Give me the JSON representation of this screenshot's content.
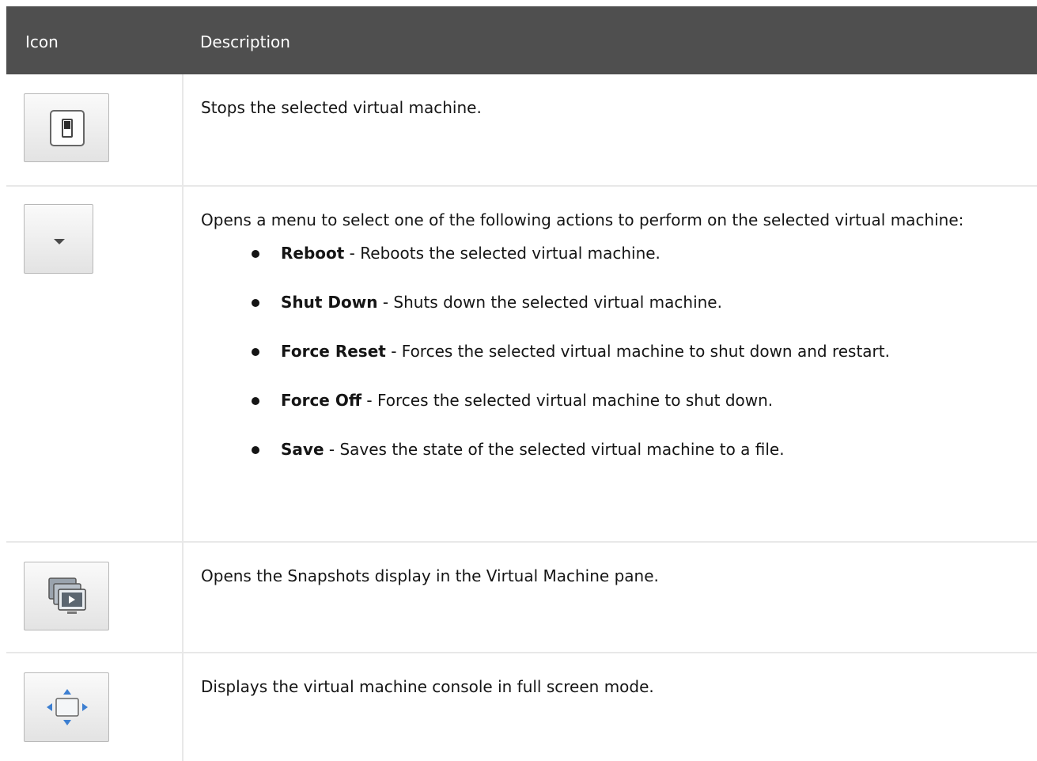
{
  "table": {
    "headers": {
      "icon": "Icon",
      "description": "Description"
    },
    "rows": [
      {
        "icon": "stop-switch-icon",
        "description": "Stops the selected virtual machine."
      },
      {
        "icon": "dropdown-arrow-icon",
        "description": "Opens a menu to select one of the following actions to perform on the selected virtual machine:",
        "actions": [
          {
            "term": "Reboot",
            "text": " - Reboots the selected virtual machine."
          },
          {
            "term": "Shut Down",
            "text": " - Shuts down the selected virtual machine."
          },
          {
            "term": "Force Reset",
            "text": " - Forces the selected virtual machine to shut down and restart."
          },
          {
            "term": "Force Off",
            "text": " - Forces the selected virtual machine to shut down."
          },
          {
            "term": "Save",
            "text": " - Saves the state of the selected virtual machine to a file."
          }
        ]
      },
      {
        "icon": "snapshots-icon",
        "description": "Opens the Snapshots display in the Virtual Machine pane."
      },
      {
        "icon": "fullscreen-icon",
        "description": "Displays the virtual machine console in full screen mode."
      }
    ]
  },
  "colors": {
    "header_bg": "#4f4f4f",
    "header_text": "#ffffff",
    "body_text": "#151515",
    "border": "#e8e8e8",
    "icon_blue": "#3d7fd1"
  }
}
